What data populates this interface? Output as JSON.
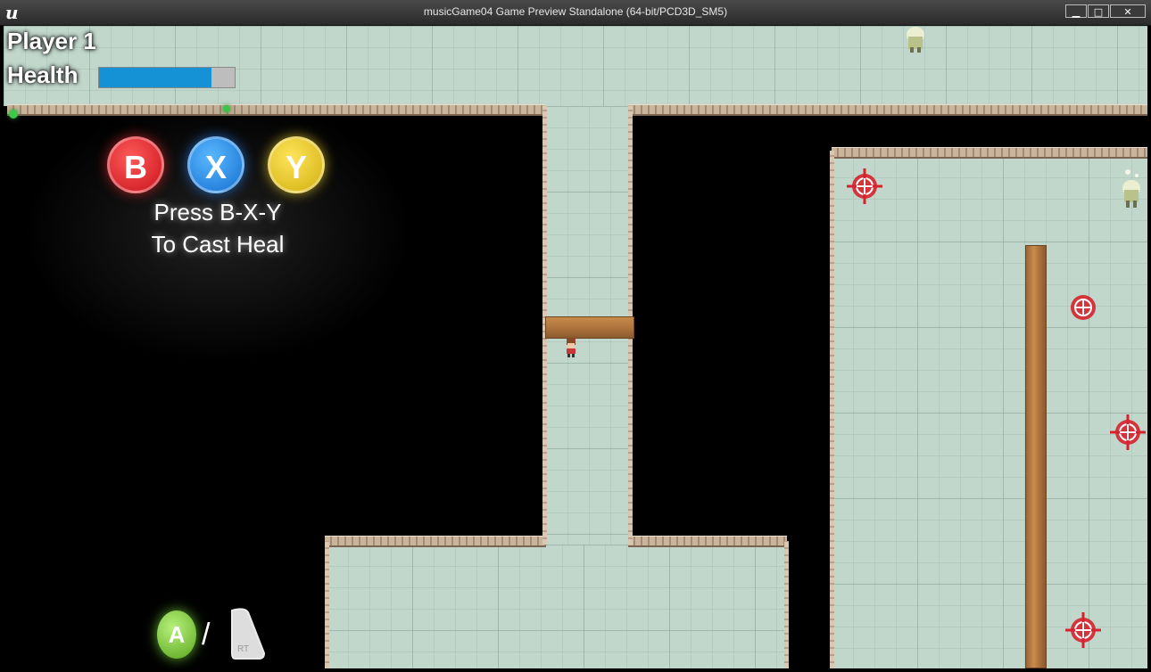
{
  "window": {
    "title": "musicGame04 Game Preview Standalone (64-bit/PCD3D_SM5)",
    "minimize_glyph": "▁",
    "maximize_glyph": "□",
    "close_glyph": "✕",
    "logo_glyph": "u"
  },
  "hud": {
    "player_label": "Player 1",
    "health_label": "Health",
    "health_fraction": 0.83
  },
  "heal_prompt": {
    "buttons": [
      "B",
      "X",
      "Y"
    ],
    "line1": "Press B-X-Y",
    "line2": "To Cast Heal"
  },
  "controls": {
    "a_button": "A",
    "separator": "/",
    "trigger_label": "RT"
  },
  "colors": {
    "health_fill": "#1591d6",
    "health_track": "#bdbdbd",
    "floor": "#c2d7cc",
    "target_red": "#d6222c"
  }
}
